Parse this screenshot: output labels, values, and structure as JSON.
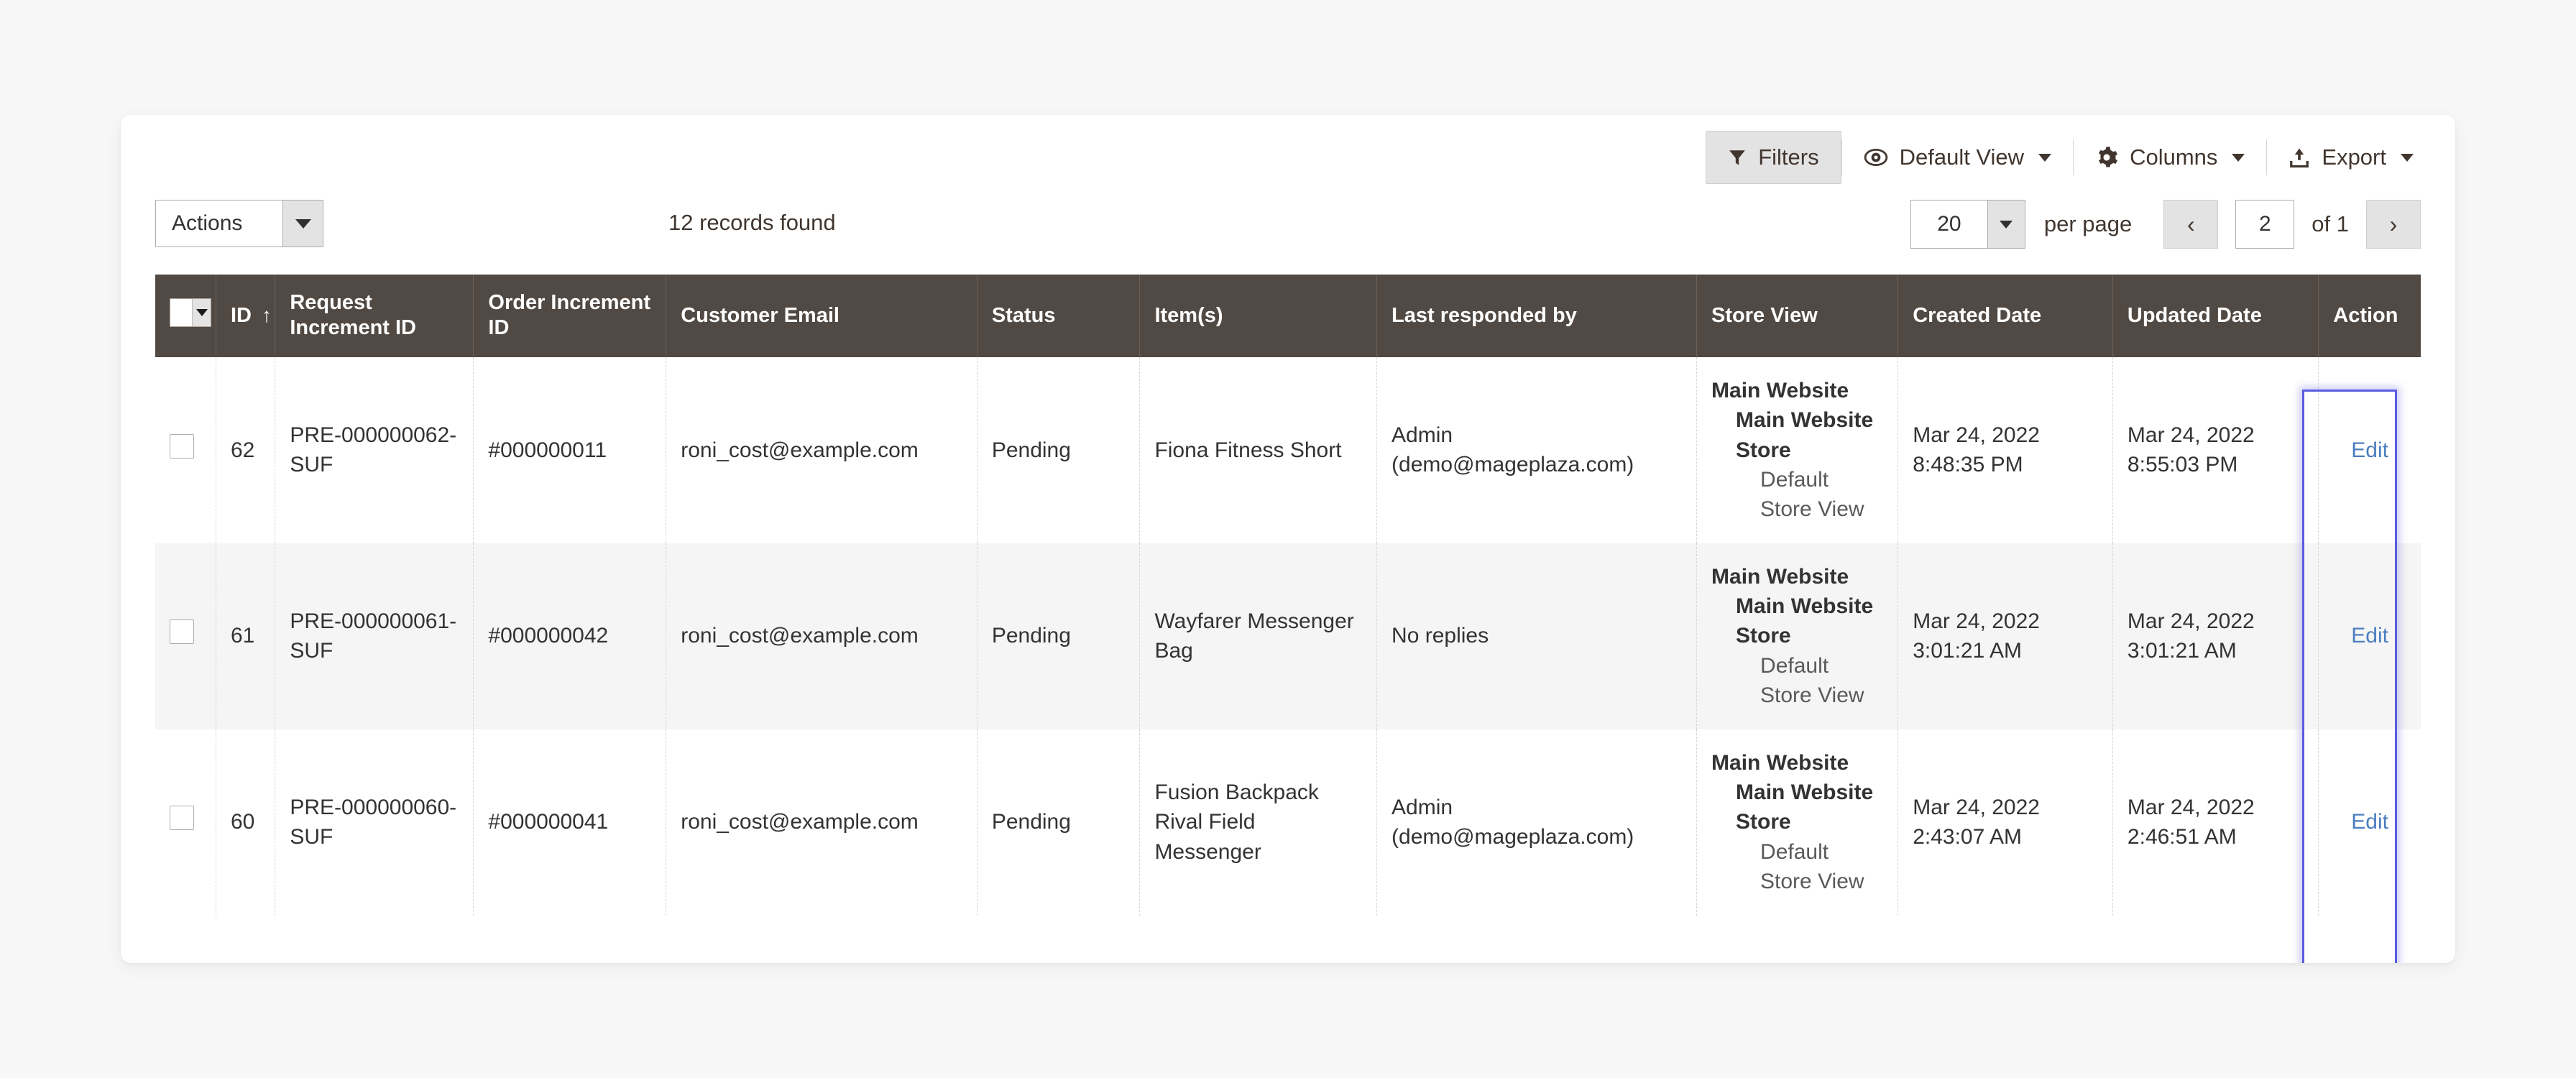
{
  "toolbar": {
    "filters_label": "Filters",
    "default_view_label": "Default View",
    "columns_label": "Columns",
    "export_label": "Export",
    "icons": {
      "filters": "funnel-icon",
      "default_view": "eye-icon",
      "columns": "gear-icon",
      "export": "upload-icon"
    }
  },
  "controls": {
    "actions_label": "Actions",
    "records_found": "12 records found",
    "per_page_value": "20",
    "per_page_label": "per page",
    "prev_label": "‹",
    "next_label": "›",
    "page_value": "2",
    "of_label": "of 1"
  },
  "table": {
    "headers": [
      "",
      "ID",
      "Request Increment ID",
      "Order Increment ID",
      "Customer Email",
      "Status",
      "Item(s)",
      "Last responded by",
      "Store View",
      "Created Date",
      "Updated Date",
      "Action"
    ],
    "sort_indicator": "↑",
    "sort_column": "ID",
    "rows": [
      {
        "id": "62",
        "request_increment_id": "PRE-000000062-SUF",
        "order_increment_id": "#000000011",
        "customer_email": "roni_cost@example.com",
        "status": "Pending",
        "items": [
          "Fiona Fitness Short"
        ],
        "last_responded_by": [
          "Admin",
          "(demo@mageplaza.com)"
        ],
        "store_view": {
          "website": "Main Website",
          "store": "Main Website Store",
          "view": "Default Store View"
        },
        "created_date": [
          "Mar 24, 2022",
          "8:48:35 PM"
        ],
        "updated_date": [
          "Mar 24, 2022",
          "8:55:03 PM"
        ],
        "action_label": "Edit"
      },
      {
        "id": "61",
        "request_increment_id": "PRE-000000061-SUF",
        "order_increment_id": "#000000042",
        "customer_email": "roni_cost@example.com",
        "status": "Pending",
        "items": [
          "Wayfarer Messenger Bag"
        ],
        "last_responded_by": [
          "No replies"
        ],
        "store_view": {
          "website": "Main Website",
          "store": "Main Website Store",
          "view": "Default Store View"
        },
        "created_date": [
          "Mar 24, 2022",
          "3:01:21 AM"
        ],
        "updated_date": [
          "Mar 24, 2022",
          "3:01:21 AM"
        ],
        "action_label": "Edit"
      },
      {
        "id": "60",
        "request_increment_id": "PRE-000000060-SUF",
        "order_increment_id": "#000000041",
        "customer_email": "roni_cost@example.com",
        "status": "Pending",
        "items": [
          "Fusion Backpack",
          "Rival Field Messenger"
        ],
        "last_responded_by": [
          "Admin",
          "(demo@mageplaza.com)"
        ],
        "store_view": {
          "website": "Main Website",
          "store": "Main Website Store",
          "view": "Default Store View"
        },
        "created_date": [
          "Mar 24, 2022",
          "2:43:07 AM"
        ],
        "updated_date": [
          "Mar 24, 2022",
          "2:46:51 AM"
        ],
        "action_label": "Edit"
      }
    ]
  },
  "colors": {
    "header_bg": "#514943",
    "page_bg": "#f7f7f7",
    "link": "#4a7ec0",
    "focus_ring": "#5b5be0",
    "row_alt": "#f5f5f5"
  }
}
